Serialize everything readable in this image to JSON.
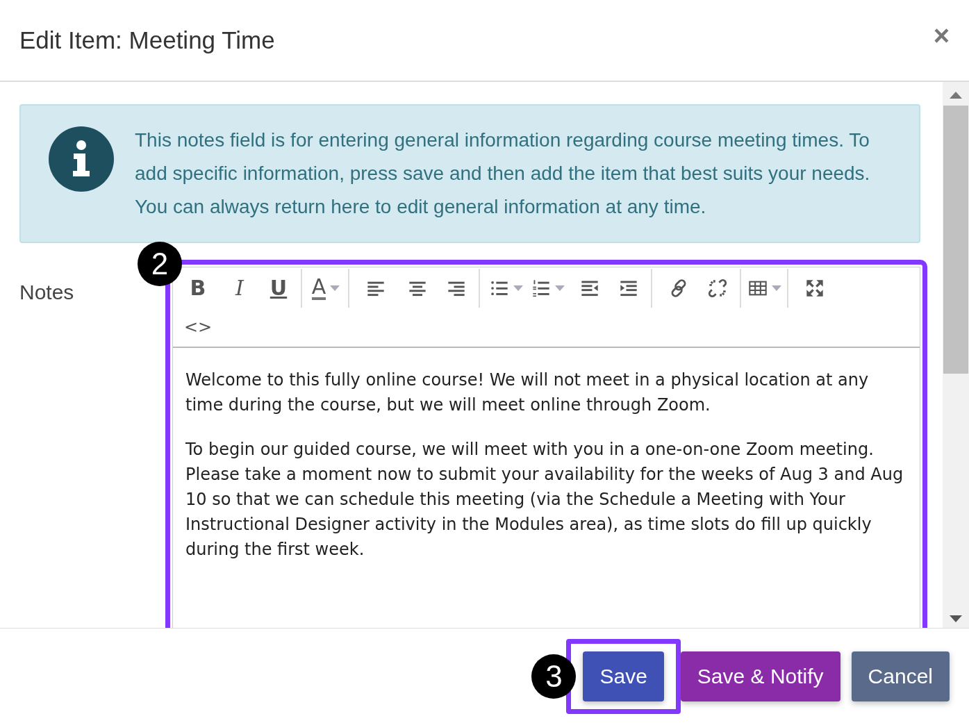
{
  "dialog": {
    "title": "Edit Item: Meeting Time",
    "close": "×"
  },
  "info": {
    "text": "This notes field is for entering general information regarding course meeting times. To add specific information, press save and then add the item that best suits your needs. You can always return here to edit general information at any time."
  },
  "notes": {
    "label": "Notes",
    "toolbar": [
      {
        "kind": "bold",
        "glyph": "B",
        "dropdown": false
      },
      {
        "kind": "italic",
        "glyph": "I",
        "dropdown": false
      },
      {
        "kind": "underline",
        "glyph": "U",
        "dropdown": false,
        "group_end": true
      },
      {
        "kind": "font-color",
        "glyph": "A",
        "dropdown": true,
        "group_end": true
      },
      {
        "kind": "align-left",
        "dropdown": false
      },
      {
        "kind": "align-center",
        "dropdown": false
      },
      {
        "kind": "align-right",
        "dropdown": false,
        "group_end": true
      },
      {
        "kind": "bullet-list",
        "dropdown": true
      },
      {
        "kind": "numbered-list",
        "dropdown": true
      },
      {
        "kind": "outdent",
        "dropdown": false
      },
      {
        "kind": "indent",
        "dropdown": false,
        "group_end": true
      },
      {
        "kind": "link",
        "dropdown": false
      },
      {
        "kind": "unlink",
        "dropdown": false,
        "group_end": true
      },
      {
        "kind": "table",
        "dropdown": true,
        "group_end": true
      },
      {
        "kind": "fullscreen",
        "dropdown": false,
        "row_end": true
      },
      {
        "kind": "code",
        "glyph": "<>",
        "dropdown": false
      }
    ],
    "paragraphs": [
      "Welcome to this fully online course! We will not meet in a physical location at any time during the course, but we will meet online through Zoom.",
      "To begin our guided course, we will meet with you in a one-on-one Zoom meeting. Please take a moment now to submit your availability for the weeks of Aug 3 and Aug 10 so that we can schedule this meeting (via the Schedule a Meeting with Your Instructional Designer activity in the Modules area), as time slots do fill up quickly during the first week."
    ],
    "callout": "2"
  },
  "buttons": [
    {
      "label": "Save",
      "kind": "primary",
      "callout": "3"
    },
    {
      "label": "Save & Notify",
      "kind": "notify"
    },
    {
      "label": "Cancel",
      "kind": "cancel"
    }
  ]
}
